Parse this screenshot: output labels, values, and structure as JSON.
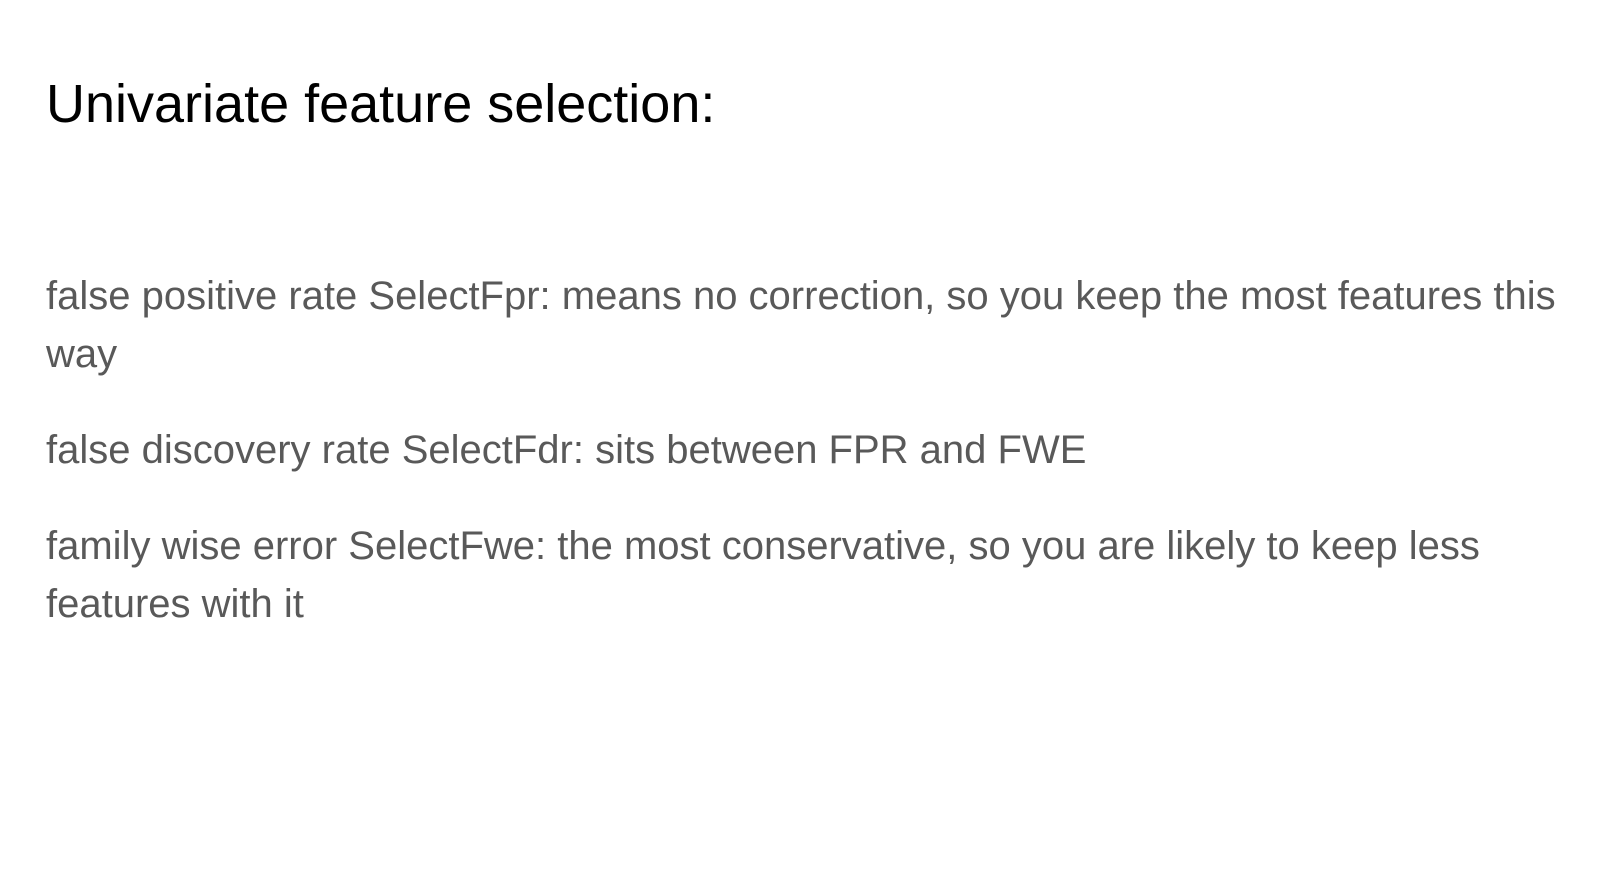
{
  "slide": {
    "title": "Univariate feature selection:",
    "paragraphs": [
      "false positive rate SelectFpr: means no correction, so you keep the most features this way",
      "false discovery rate SelectFdr: sits between FPR and FWE",
      "family wise error SelectFwe: the most conservative, so you are likely to keep less features with it"
    ]
  },
  "colors": {
    "background": "#ffffff",
    "title": "#000000",
    "body_text": "#595959"
  }
}
